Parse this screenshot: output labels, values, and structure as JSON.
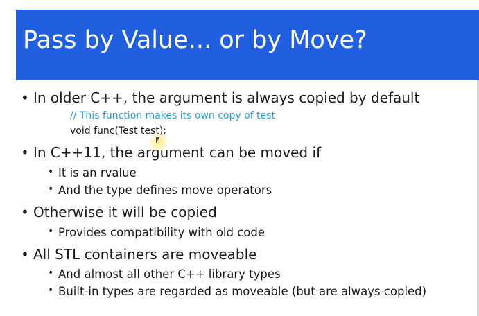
{
  "slide": {
    "title": "Pass by Value... or by Move?",
    "colors": {
      "title_bar": "#1f5fe0",
      "title_text": "#ffffff",
      "body_text": "#1a1a1a",
      "comment_text": "#1f9ed9"
    },
    "bullets": {
      "b1": "In older C++, the argument is always copied by default",
      "b1_comment": "// This function makes its own copy of test",
      "b1_code": "void func(Test test);",
      "b2": "In C++11, the argument can be moved if",
      "b2_sub1": "It is an rvalue",
      "b2_sub2": "And the type defines move operators",
      "b3": "Otherwise it will be copied",
      "b3_sub1": "Provides compatibility with old code",
      "b4": "All STL containers are moveable",
      "b4_sub1": "And almost all other C++ library types",
      "b4_sub2": "Built-in types are regarded as moveable (but are always copied)"
    },
    "bullet_glyph": "•",
    "pointer_icon": "mouse-pointer-highlight-icon"
  }
}
